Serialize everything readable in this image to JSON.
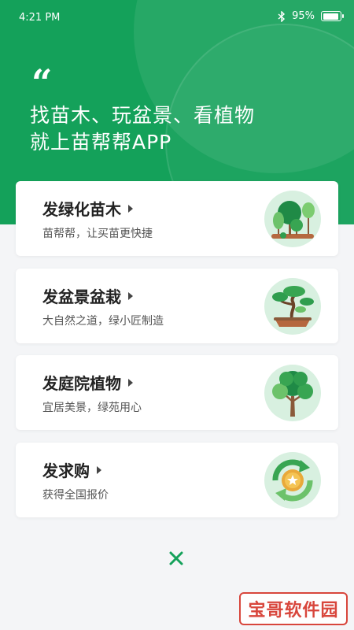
{
  "status_bar": {
    "time": "4:21 PM",
    "battery_percent": "95%",
    "battery_level": 0.95
  },
  "hero": {
    "quote_mark": "“",
    "headline_line1": "找苗木、玩盆景、看植物",
    "headline_line2": "就上苗帮帮APP"
  },
  "cards": [
    {
      "title": "发绿化苗木",
      "subtitle": "苗帮帮，让买苗更快捷"
    },
    {
      "title": "发盆景盆栽",
      "subtitle": "大自然之道，绿小匠制造"
    },
    {
      "title": "发庭院植物",
      "subtitle": "宜居美景，绿苑用心"
    },
    {
      "title": "发求购",
      "subtitle": "获得全国报价"
    }
  ],
  "close_icon": "close-icon",
  "watermark": "宝哥软件园",
  "colors": {
    "brand_green": "#14a15a",
    "icon_bg": "#d8f0e0",
    "watermark_red": "#d8463c"
  }
}
